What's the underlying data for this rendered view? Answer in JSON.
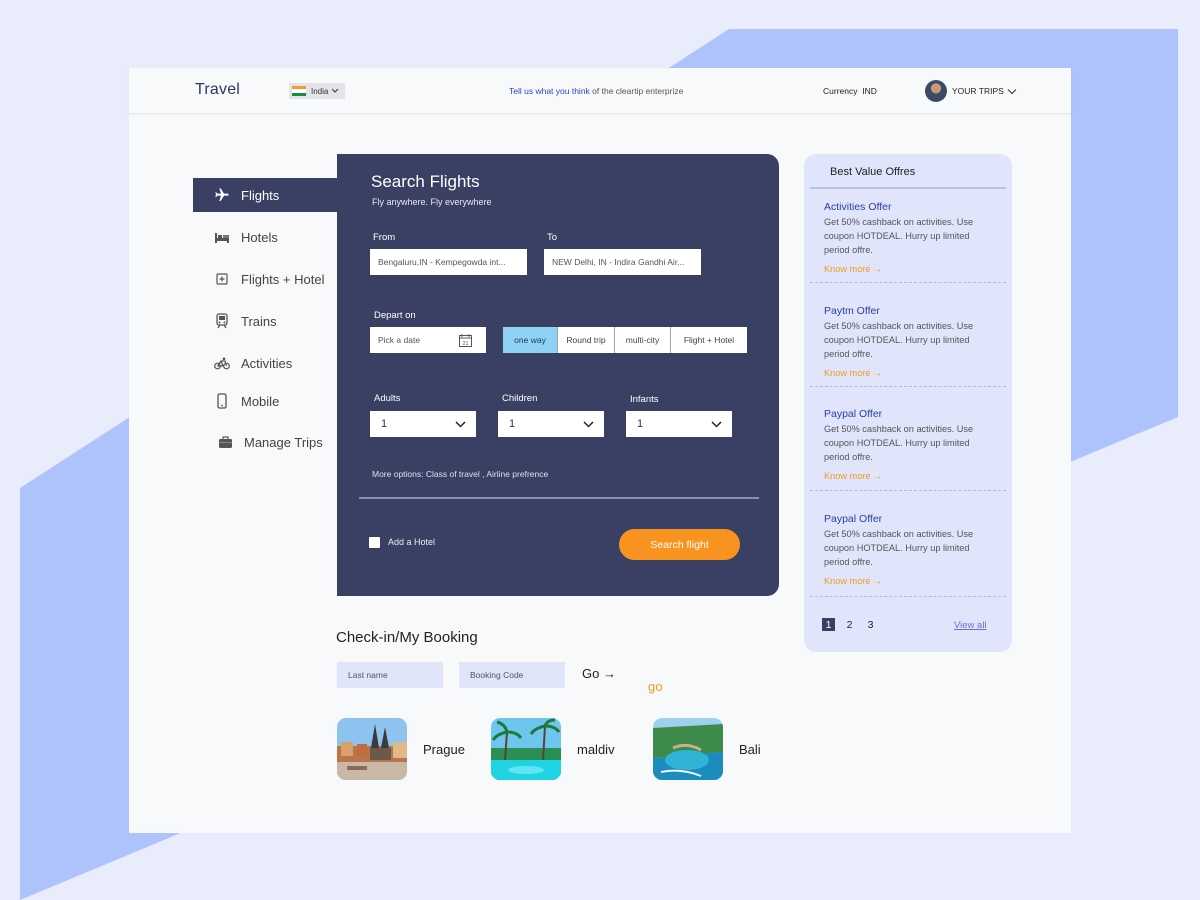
{
  "header": {
    "logo_main": "Travel",
    "logo_accent": "go",
    "country": "India",
    "feedback_link": "Tell us what you think",
    "feedback_rest": " of the cleartip enterprize",
    "currency_label": "Currency",
    "currency_value": "IND",
    "trips_label": "YOUR TRIPS"
  },
  "sidebar": {
    "items": [
      {
        "label": "Flights",
        "icon": "plane-icon"
      },
      {
        "label": "Hotels",
        "icon": "bed-icon"
      },
      {
        "label": "Flights + Hotel",
        "icon": "flight-hotel-icon"
      },
      {
        "label": "Trains",
        "icon": "train-icon"
      },
      {
        "label": "Activities",
        "icon": "bicycle-icon"
      },
      {
        "label": "Mobile",
        "icon": "mobile-icon"
      },
      {
        "label": "Manage Trips",
        "icon": "briefcase-icon"
      }
    ]
  },
  "search": {
    "title": "Search Flights",
    "subtitle": "Fly anywhere. Fly everywhere",
    "from_label": "From",
    "from_value": "Bengaluru,IN - Kempegowda int...",
    "to_label": "To",
    "to_value": "NEW Delhi, IN - Indira Gandhi Air...",
    "depart_label": "Depart on",
    "date_placeholder": "Pick a date",
    "calendar_day": "21",
    "trip_types": [
      "one way",
      "Round trip",
      "multi-city",
      "Flight + Hotel"
    ],
    "adults_label": "Adults",
    "adults_value": "1",
    "children_label": "Children",
    "children_value": "1",
    "infants_label": "Infants",
    "infants_value": "1",
    "more_options": "More options: Class of travel , Airline prefrence",
    "add_hotel": "Add a Hotel",
    "search_button": "Search flight"
  },
  "checkin": {
    "title": "Check-in/My Booking",
    "lastname_placeholder": "Last name",
    "booking_placeholder": "Booking Code",
    "go_label": "Go →"
  },
  "destinations": [
    "Prague",
    "maldiv",
    "Bali"
  ],
  "offers": {
    "title": "Best Value Offres",
    "items": [
      {
        "title": "Activities Offer",
        "desc": "Get 50% cashback on activities. Use coupon HOTDEAL. Hurry up limited period offre.",
        "link": "Know more  →"
      },
      {
        "title": "Paytm Offer",
        "desc": "Get 50% cashback on activities. Use coupon HOTDEAL. Hurry up limited period offre.",
        "link": "Know more  →"
      },
      {
        "title": "Paypal Offer",
        "desc": "Get 50% cashback on activities. Use coupon HOTDEAL. Hurry up limited period offre.",
        "link": "Know more  →"
      },
      {
        "title": "Paypal Offer",
        "desc": "Get 50% cashback on activities. Use coupon HOTDEAL. Hurry up limited period offre.",
        "link": "Know more  →"
      }
    ],
    "pages": [
      "1",
      "2",
      "3"
    ],
    "view_all": "View all"
  },
  "colors": {
    "panel": "#3a4064",
    "accent": "#f7931e",
    "offers_bg": "#e0e5fc",
    "selected_tab": "#8fd3f4"
  }
}
